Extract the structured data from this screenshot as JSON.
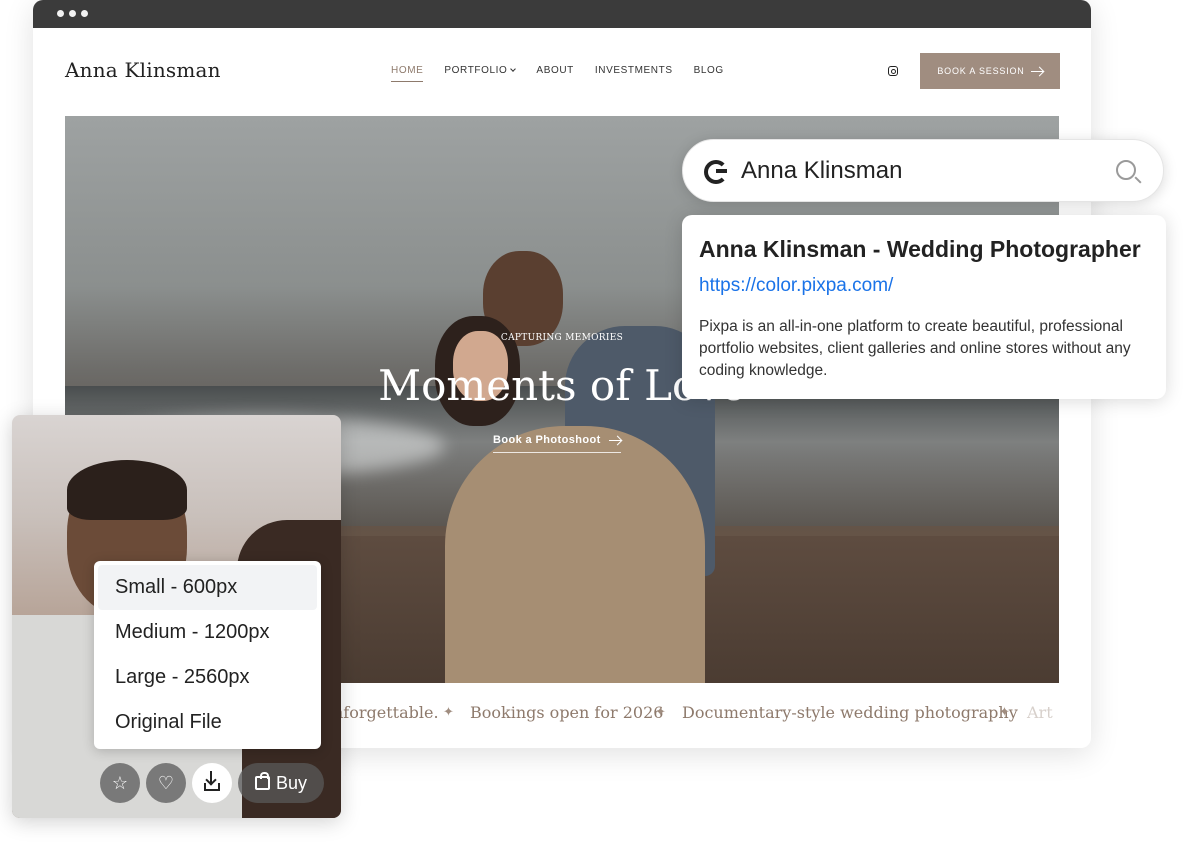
{
  "site": {
    "logo": "Anna Klinsman",
    "nav": [
      {
        "label": "HOME",
        "active": true
      },
      {
        "label": "PORTFOLIO",
        "has_dropdown": true
      },
      {
        "label": "ABOUT"
      },
      {
        "label": "INVESTMENTS"
      },
      {
        "label": "BLOG"
      }
    ],
    "social_icon": "instagram-icon",
    "book_button": "BOOK A SESSION",
    "accent_color": "#a08d80"
  },
  "hero": {
    "eyebrow": "CAPTURING MEMORIES",
    "title": "Moments of Love",
    "cta": "Book a Photoshoot"
  },
  "ticker": {
    "items": [
      "nforgettable.",
      "Bookings open for 2026",
      "Documentary-style wedding photography",
      "Art"
    ],
    "separator": "✦"
  },
  "google": {
    "query": "Anna Klinsman",
    "result_title": "Anna Klinsman -  Wedding Photographer",
    "result_url": "https://color.pixpa.com/",
    "result_desc": "Pixpa is an all-in-one platform to create beautiful, professional portfolio websites, client galleries and online stores without any coding knowledge.",
    "url_color": "#1a73e8"
  },
  "product": {
    "sizes": [
      {
        "label": "Small - 600px",
        "selected": true
      },
      {
        "label": "Medium - 1200px"
      },
      {
        "label": "Large - 2560px"
      },
      {
        "label": "Original File"
      }
    ],
    "buy_label": "Buy"
  }
}
